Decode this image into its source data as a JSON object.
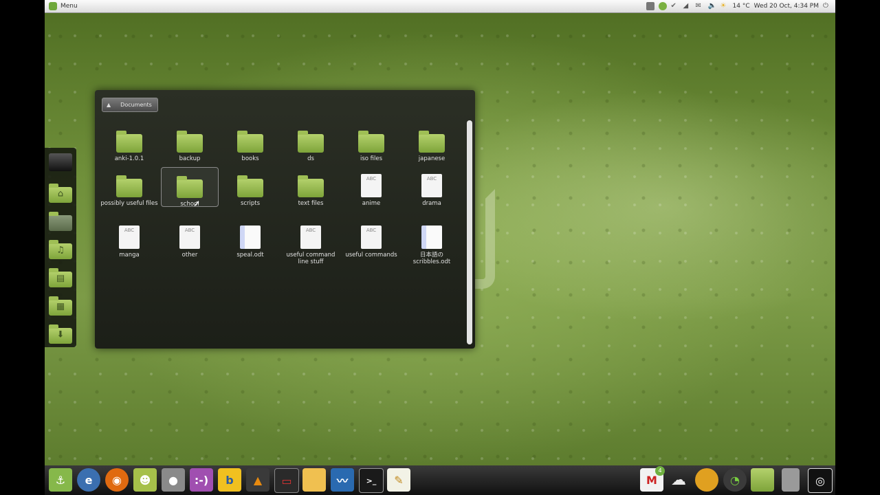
{
  "top_panel": {
    "menu_label": "Menu",
    "temperature": "14 °C",
    "clock": "Wed 20 Oct, 4:34 PM"
  },
  "stack": {
    "breadcrumb": "Documents",
    "items": [
      {
        "label": "anki-1.0.1",
        "type": "folder"
      },
      {
        "label": "backup",
        "type": "folder"
      },
      {
        "label": "books",
        "type": "folder"
      },
      {
        "label": "ds",
        "type": "folder"
      },
      {
        "label": "iso files",
        "type": "folder"
      },
      {
        "label": "japanese",
        "type": "folder"
      },
      {
        "label": "possibly useful files",
        "type": "folder"
      },
      {
        "label": "school",
        "type": "folder"
      },
      {
        "label": "scripts",
        "type": "folder"
      },
      {
        "label": "text files",
        "type": "folder"
      },
      {
        "label": "anime",
        "type": "text"
      },
      {
        "label": "drama",
        "type": "text"
      },
      {
        "label": "manga",
        "type": "text"
      },
      {
        "label": "other",
        "type": "text"
      },
      {
        "label": "speal.odt",
        "type": "odt"
      },
      {
        "label": "useful command line stuff",
        "type": "text"
      },
      {
        "label": "useful commands",
        "type": "text"
      },
      {
        "label": "日本語の scribbles.odt",
        "type": "odt"
      }
    ],
    "doc_icon_text": "ABC"
  },
  "left_dock": [
    "computer",
    "home",
    "desktop",
    "music",
    "documents",
    "videos",
    "downloads"
  ],
  "bottom_dock": {
    "colors": {
      "mint": "#86b84a",
      "ie": "#3b6fb0",
      "firefox": "#e06a10",
      "android": "#a6c04a",
      "gray": "#8a8a8a",
      "pidgin": "#a04fb0",
      "b": "#f0c020",
      "vlc": "#e88a10",
      "terminal": "#1a1a1a",
      "gedit": "#f2f2e6"
    },
    "mail_badge": "4"
  }
}
